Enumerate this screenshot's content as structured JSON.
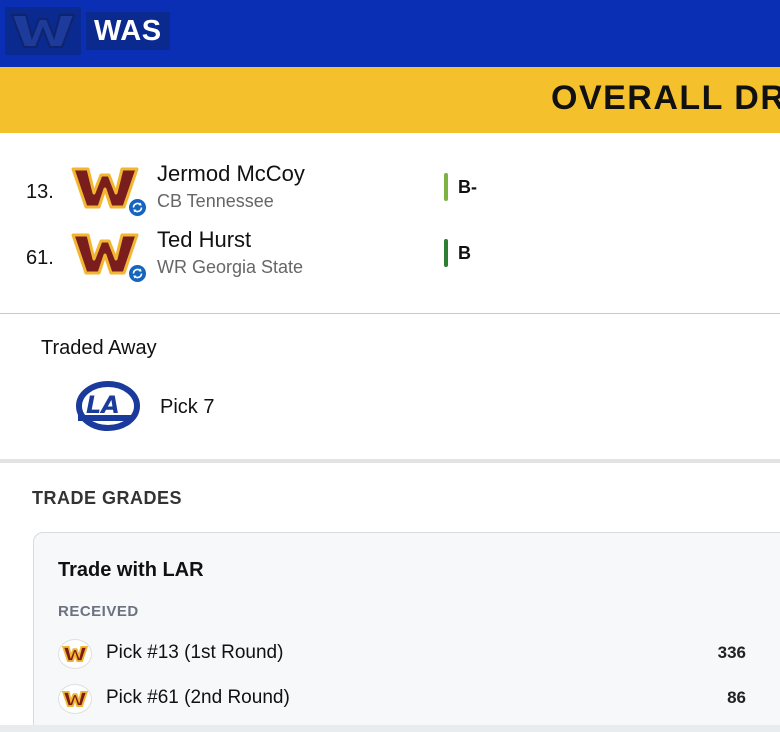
{
  "header": {
    "team_logo_icon": "commanders-w-logo",
    "team_abbr": "WAS",
    "banner_text": "OVERALL DRA",
    "brand_blue": "#0a2fb4",
    "banner_yellow": "#f4c12c"
  },
  "picks": [
    {
      "number": "13.",
      "name": "Jermod McCoy",
      "meta": "CB Tennessee",
      "grade": "B-",
      "grade_color": "#7cb342",
      "logo_icon": "commanders-w-logo",
      "badge_icon": "trade-swap-icon"
    },
    {
      "number": "61.",
      "name": "Ted Hurst",
      "meta": "WR Georgia State",
      "grade": "B",
      "grade_color": "#2e7d32",
      "logo_icon": "commanders-w-logo",
      "badge_icon": "trade-swap-icon"
    }
  ],
  "traded_away": {
    "title": "Traded Away",
    "logo_icon": "rams-la-logo",
    "pick": "Pick 7"
  },
  "trade_grades": {
    "title": "TRADE GRADES",
    "card_title": "Trade with LAR",
    "received_label": "RECEIVED",
    "received": [
      {
        "label": "Pick #13 (1st Round)",
        "value": "336",
        "logo_icon": "commanders-w-logo"
      },
      {
        "label": "Pick #61 (2nd Round)",
        "value": "86",
        "logo_icon": "commanders-w-logo"
      }
    ]
  }
}
